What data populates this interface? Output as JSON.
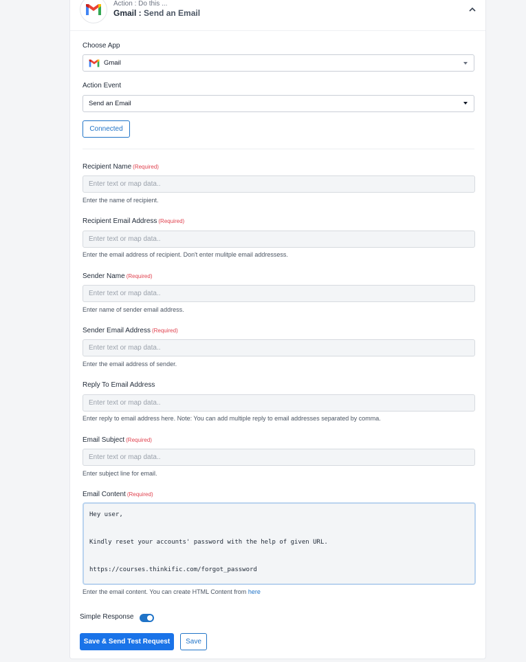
{
  "header": {
    "subtitle": "Action : Do this ...",
    "app_name": "Gmail :",
    "event_name": "Send an Email"
  },
  "choose_app": {
    "label": "Choose App",
    "value": "Gmail"
  },
  "action_event": {
    "label": "Action Event",
    "value": "Send an Email"
  },
  "connected_label": "Connected",
  "required_tag": "(Required)",
  "fields": [
    {
      "label": "Recipient Name",
      "required": true,
      "placeholder": "Enter text or map data..",
      "help": "Enter the name of recipient."
    },
    {
      "label": "Recipient Email Address",
      "required": true,
      "placeholder": "Enter text or map data..",
      "help": "Enter the email address of recipient. Don't enter mulitple email addressess."
    },
    {
      "label": "Sender Name",
      "required": true,
      "placeholder": "Enter text or map data..",
      "help": "Enter name of sender email address."
    },
    {
      "label": "Sender Email Address",
      "required": true,
      "placeholder": "Enter text or map data..",
      "help": "Enter the email address of sender."
    },
    {
      "label": "Reply To Email Address",
      "required": false,
      "placeholder": "Enter text or map data..",
      "help": "Enter reply to email address here. Note: You can add multiple reply to email addresses separated by comma."
    },
    {
      "label": "Email Subject",
      "required": true,
      "placeholder": "Enter text or map data..",
      "help": "Enter subject line for email."
    }
  ],
  "email_content": {
    "label": "Email Content",
    "lines": [
      "Hey user,",
      "",
      "",
      "",
      "Kindly reset your accounts' password with the help of given URL.",
      "",
      "",
      "",
      "https://courses.thinkific.com/forgot_password"
    ],
    "help": "Enter the email content. You can create HTML Content from",
    "help_link": "here"
  },
  "simple_response": {
    "label": "Simple Response",
    "enabled": true
  },
  "buttons": {
    "save_and_test": "Save & Send Test Request",
    "save": "Save"
  },
  "colors": {
    "accent": "#1a73e8",
    "required": "#e0414e",
    "input_bg": "#f3f5f7"
  },
  "icons": {
    "app": "gmail-icon",
    "collapse": "chevron-up-icon",
    "dropdown": "caret-down-icon"
  }
}
